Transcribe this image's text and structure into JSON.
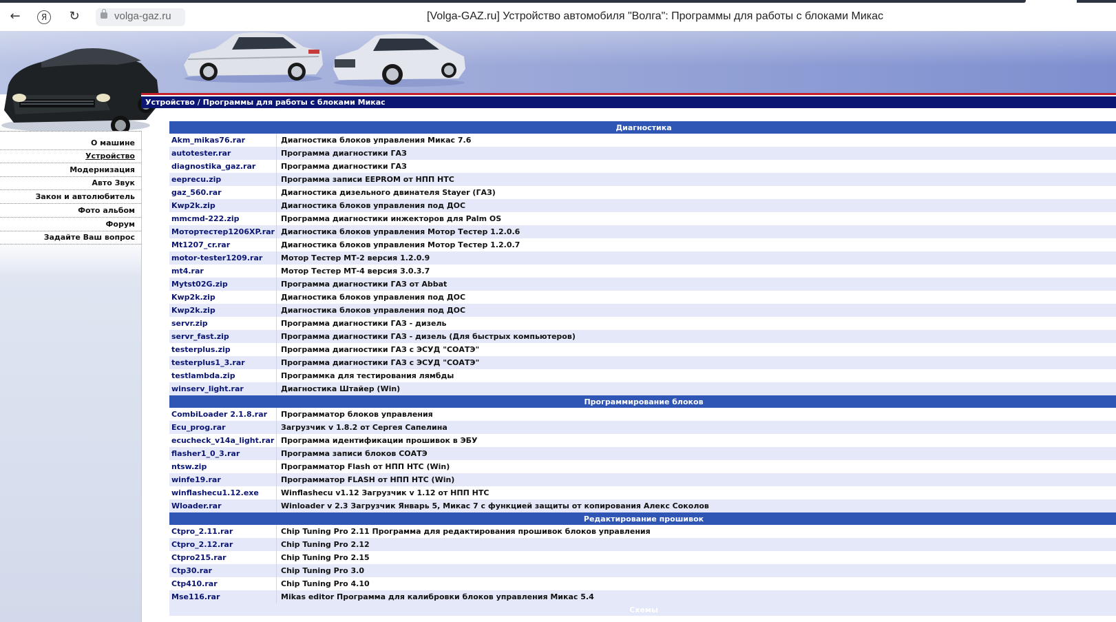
{
  "browser": {
    "back_icon": "←",
    "home_icon": "Я",
    "reload_icon": "↻",
    "url": "volga-gaz.ru",
    "page_title": "[Volga-GAZ.ru] Устройство автомобиля \"Волга\": Программы для работы с блоками Микас"
  },
  "breadcrumb": "Устройство / Программы для работы с блоками Микас",
  "menu": [
    {
      "label": "О машине",
      "active": false
    },
    {
      "label": "Устройство",
      "active": true
    },
    {
      "label": "Модернизация",
      "active": false
    },
    {
      "label": "Авто Звук",
      "active": false
    },
    {
      "label": "Закон и автолюбитель",
      "active": false
    },
    {
      "label": "Фото альбом",
      "active": false
    },
    {
      "label": "Форум",
      "active": false
    },
    {
      "label": "Задайте Ваш вопрос",
      "active": false
    }
  ],
  "sections": [
    {
      "title": "Диагностика",
      "rows": [
        {
          "file": "Akm_mikas76.rar",
          "desc": "Диагностика блоков управления Микас 7.6"
        },
        {
          "file": "autotester.rar",
          "desc": "Программа диагностики ГАЗ"
        },
        {
          "file": "diagnostika_gaz.rar",
          "desc": "Программа диагностики ГАЗ"
        },
        {
          "file": "eeprecu.zip",
          "desc": "Программа записи EEPROM от НПП НТС"
        },
        {
          "file": "gaz_560.rar",
          "desc": "Диагностика дизельного двинателя Stayer (ГАЗ)"
        },
        {
          "file": "Kwp2k.zip",
          "desc": "Диагностика блоков управления под ДОС"
        },
        {
          "file": "mmcmd-222.zip",
          "desc": "Программа диагностики инжекторов для Palm OS"
        },
        {
          "file": "Мотортестер1206XP.rar",
          "desc": "Диагностика блоков управления Мотор Тестер 1.2.0.6"
        },
        {
          "file": "Mt1207_cr.rar",
          "desc": "Диагностика блоков управления Мотор Тестер 1.2.0.7"
        },
        {
          "file": "motor-tester1209.rar",
          "desc": "Мотор Тестер МТ-2 версия 1.2.0.9"
        },
        {
          "file": "mt4.rar",
          "desc": "Мотор Тестер МТ-4 версия 3.0.3.7"
        },
        {
          "file": "Mytst02G.zip",
          "desc": "Программа диагностики ГАЗ от Abbat"
        },
        {
          "file": "Kwp2k.zip",
          "desc": "Диагностика блоков управления под ДОС"
        },
        {
          "file": "Kwp2k.zip",
          "desc": "Диагностика блоков управления под ДОС"
        },
        {
          "file": "servr.zip",
          "desc": "Программа диагностики ГАЗ - дизель"
        },
        {
          "file": "servr_fast.zip",
          "desc": "Программа диагностики ГАЗ - дизель (Для быстрых компьютеров)"
        },
        {
          "file": "testerplus.zip",
          "desc": "Программа диагностики ГАЗ с ЭСУД \"СОАТЭ\""
        },
        {
          "file": "testerplus1_3.rar",
          "desc": "Программа диагностики ГАЗ с ЭСУД \"СОАТЭ\""
        },
        {
          "file": "testlambda.zip",
          "desc": "Программка для тестирования лямбды"
        },
        {
          "file": "winserv_light.rar",
          "desc": "Диагностика Штайер (Win)"
        }
      ]
    },
    {
      "title": "Программирование блоков",
      "rows": [
        {
          "file": "CombiLoader 2.1.8.rar",
          "desc": "Программатор блоков управления"
        },
        {
          "file": "Ecu_prog.rar",
          "desc": "Загрузчик v 1.8.2 от Сергея Сапелина"
        },
        {
          "file": "ecucheck_v14a_light.rar",
          "desc": "Программа идентификации прошивок в ЭБУ"
        },
        {
          "file": "flasher1_0_3.rar",
          "desc": "Программа записи блоков СОАТЭ"
        },
        {
          "file": "ntsw.zip",
          "desc": "Программатор Flash от НПП НТС (Win)"
        },
        {
          "file": "winfe19.rar",
          "desc": "Программатор FLASH от НПП НТС (Win)"
        },
        {
          "file": "winflashecu1.12.exe",
          "desc": "Winflashecu v1.12 Загрузчик v 1.12 от НПП НТС"
        },
        {
          "file": "Wloader.rar",
          "desc": "Winloader v 2.3 Загрузчик Январь 5, Микас 7 с функцией защиты от копирования Алекс Соколов"
        }
      ]
    },
    {
      "title": "Редактирование прошивок",
      "rows": [
        {
          "file": "Ctpro_2.11.rar",
          "desc": "Chip Tuning Pro 2.11 Программа для редактирования прошивок блоков управления"
        },
        {
          "file": "Ctpro_2.12.rar",
          "desc": "Chip Tuning Pro 2.12"
        },
        {
          "file": "Ctpro215.rar",
          "desc": "Chip Tuning Pro 2.15"
        },
        {
          "file": "Ctp30.rar",
          "desc": "Chip Tuning Pro 3.0"
        },
        {
          "file": "Ctp410.rar",
          "desc": "Chip Tuning Pro 4.10"
        },
        {
          "file": "Mse116.rar",
          "desc": "Mikas editor Программа для калибровки блоков управления Микас 5.4"
        }
      ]
    },
    {
      "title": "Схемы",
      "faint": true,
      "rows": []
    }
  ],
  "colors": {
    "breadcrumb_bg": "#0b1673",
    "section_bg": "#2f56b5",
    "alt_row": "#e4e8f8",
    "link": "#0b1673",
    "accent_red": "#c81e2b"
  }
}
